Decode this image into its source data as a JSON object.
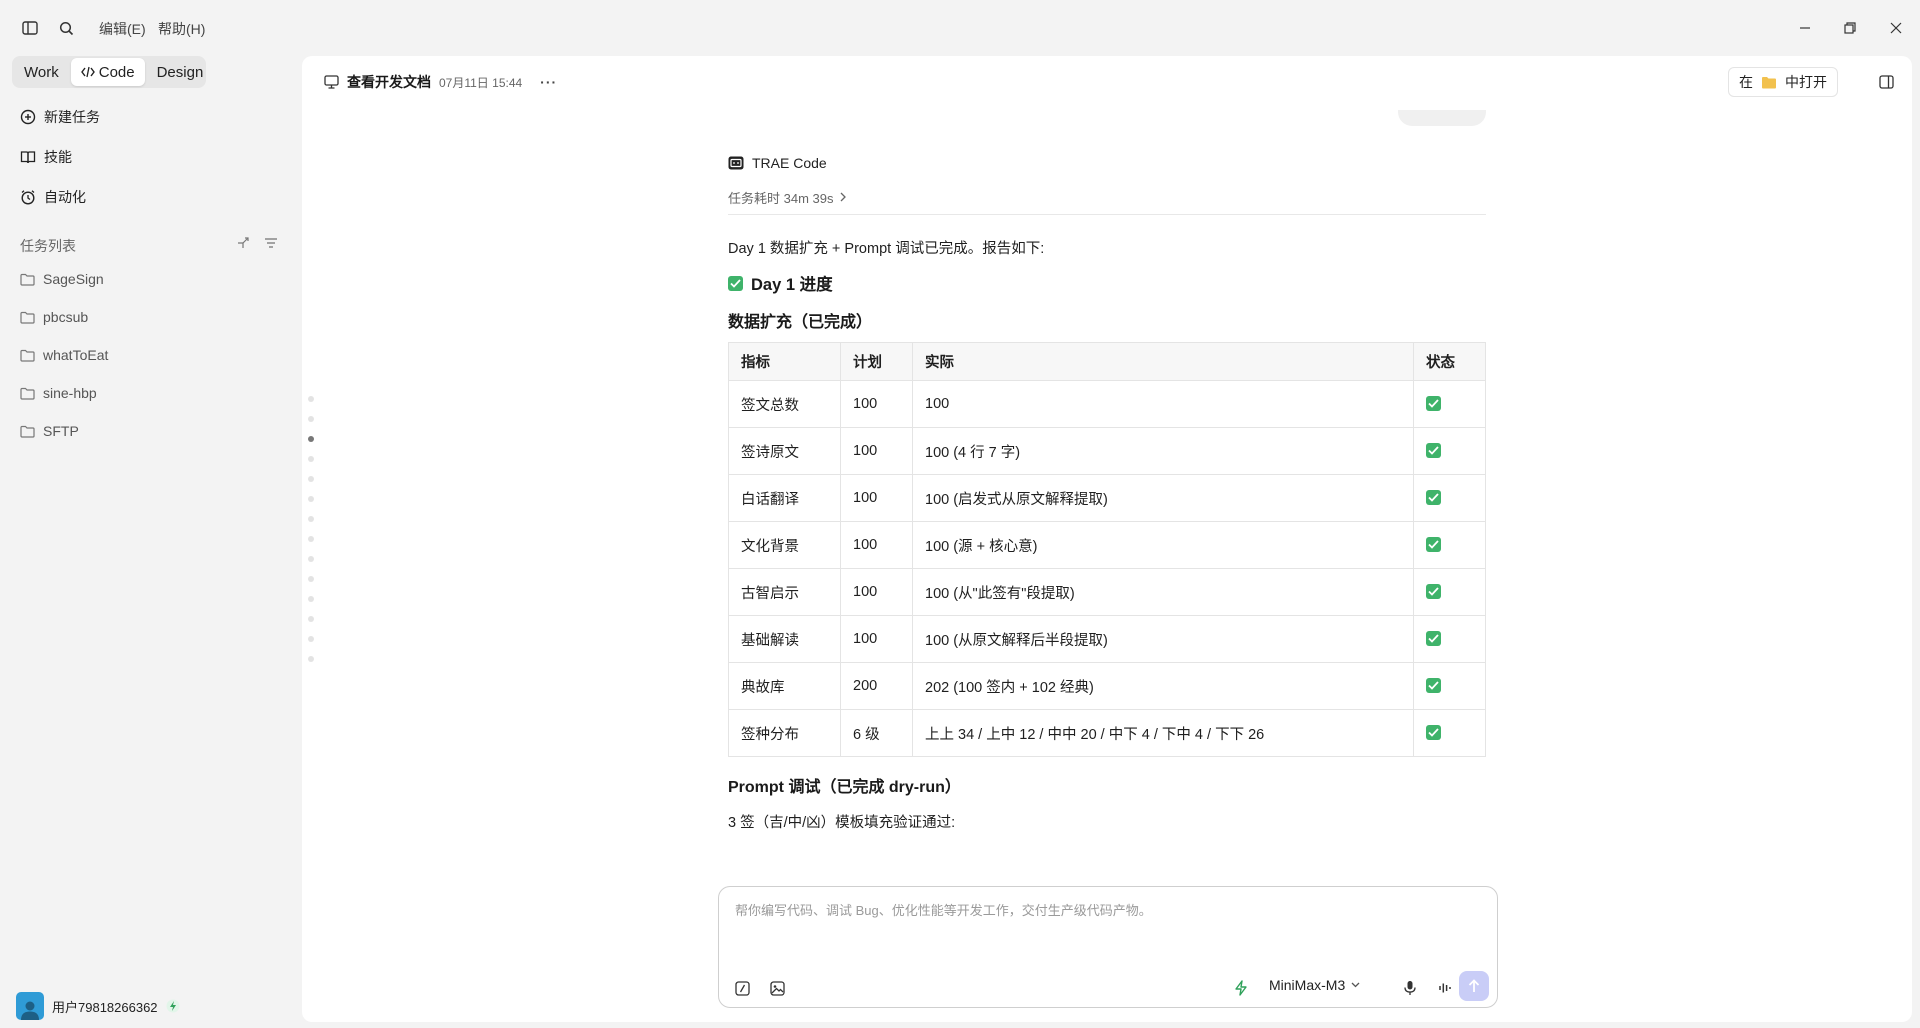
{
  "menu": {
    "edit": "编辑(E)",
    "help": "帮助(H)"
  },
  "modes": [
    "Work",
    "Code",
    "Design"
  ],
  "nav": {
    "new_task": "新建任务",
    "skills": "技能",
    "automation": "自动化"
  },
  "task_list": {
    "title": "任务列表",
    "projects": [
      "SageSign",
      "pbcsub",
      "whatToEat",
      "sine-hbp",
      "SFTP"
    ]
  },
  "user": {
    "name": "用户79818266362"
  },
  "header": {
    "title": "查看开发文档",
    "timestamp": "07月11日 15:44",
    "more": "···",
    "open_prefix": "在",
    "open_suffix": "中打开"
  },
  "message": {
    "agent": "TRAE Code",
    "duration": "任务耗时 34m 39s",
    "intro": "Day 1 数据扩充 + Prompt 调试已完成。报告如下:",
    "progress_title": "Day 1 进度",
    "data_section_title": "数据扩充（已完成）",
    "table": {
      "headers": [
        "指标",
        "计划",
        "实际",
        "状态"
      ],
      "rows": [
        [
          "签文总数",
          "100",
          "100"
        ],
        [
          "签诗原文",
          "100",
          "100 (4 行 7 字)"
        ],
        [
          "白话翻译",
          "100",
          "100 (启发式从原文解释提取)"
        ],
        [
          "文化背景",
          "100",
          "100 (源 + 核心意)"
        ],
        [
          "古智启示",
          "100",
          "100 (从\"此签有\"段提取)"
        ],
        [
          "基础解读",
          "100",
          "100 (从原文解释后半段提取)"
        ],
        [
          "典故库",
          "200",
          "202 (100 签内 + 102 经典)"
        ],
        [
          "签种分布",
          "6 级",
          "上上 34 / 上中 12 / 中中 20 / 中下 4 / 下中 4 / 下下 26"
        ]
      ]
    },
    "prompt_section_title": "Prompt 调试（已完成 dry-run）",
    "prompt_text": "3 签（吉/中/凶）模板填充验证通过:"
  },
  "composer": {
    "placeholder": "帮你编写代码、调试 Bug、优化性能等开发工作，交付生产级代码产物。",
    "model": "MiniMax-M3"
  },
  "colors": {
    "accent": "#3fb36a",
    "send": "#c9cdf7",
    "avatar": "#2f9bd6"
  }
}
